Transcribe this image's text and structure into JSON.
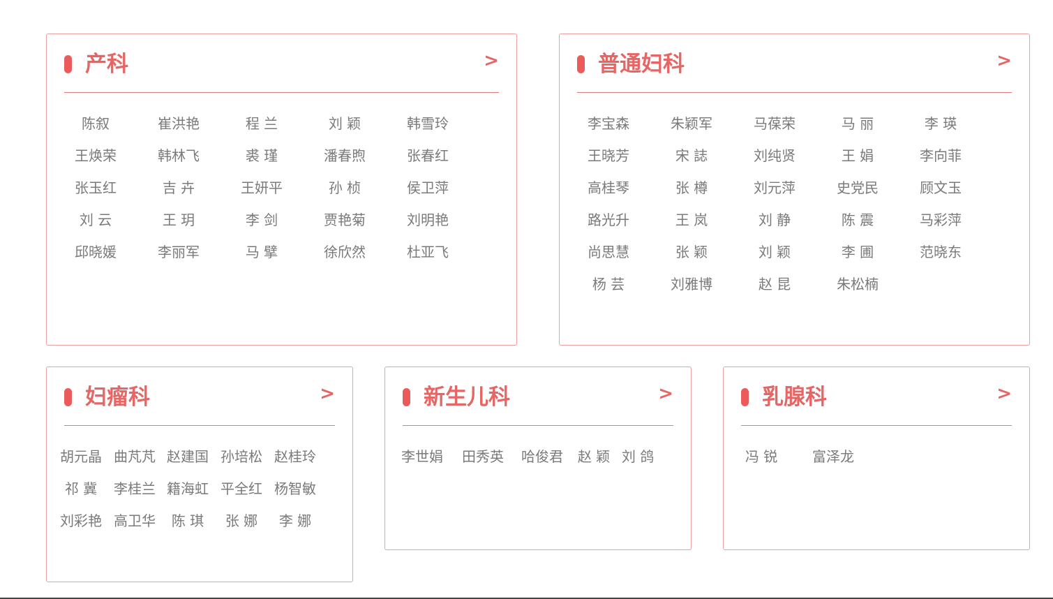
{
  "sections": [
    {
      "title": "产科",
      "more": ">",
      "doctors": [
        "陈叙",
        "崔洪艳",
        "程 兰",
        "刘 颖",
        "韩雪玲",
        "王焕荣",
        "韩林飞",
        "裘 瑾",
        "潘春煦",
        "张春红",
        "张玉红",
        "吉 卉",
        "王妍平",
        "孙 桢",
        "侯卫萍",
        "刘 云",
        "王 玥",
        "李 剑",
        "贾艳菊",
        "刘明艳",
        "邱晓媛",
        "李丽军",
        "马 擘",
        "徐欣然",
        "杜亚飞"
      ]
    },
    {
      "title": "普通妇科",
      "more": ">",
      "doctors": [
        "李宝森",
        "朱颖军",
        "马葆荣",
        "马 丽",
        "李 瑛",
        "王晓芳",
        "宋 誌",
        "刘纯贤",
        "王 娟",
        "李向菲",
        "高桂琴",
        "张 樽",
        "刘元萍",
        "史党民",
        "顾文玉",
        "路光升",
        "王 岚",
        "刘 静",
        "陈 震",
        "马彩萍",
        "尚思慧",
        "张 颖",
        "刘 颖",
        "李 圃",
        "范晓东",
        "杨 芸",
        "刘雅博",
        "赵 昆",
        "朱松楠"
      ]
    },
    {
      "title": "妇瘤科",
      "more": ">",
      "doctors": [
        "胡元晶",
        "曲芃芃",
        "赵建国",
        "孙培松",
        "赵桂玲",
        "祁 冀",
        "李桂兰",
        "籍海虹",
        "平全红",
        "杨智敏",
        "刘彩艳",
        "高卫华",
        "陈 琪",
        "张 娜",
        "李 娜"
      ]
    },
    {
      "title": "新生儿科",
      "more": ">",
      "doctors": [
        "李世娟",
        "田秀英",
        "哈俊君",
        "赵 颖",
        "刘 鸽"
      ]
    },
    {
      "title": "乳腺科",
      "more": ">",
      "doctors": [
        "冯 锐",
        "富泽龙"
      ]
    }
  ]
}
